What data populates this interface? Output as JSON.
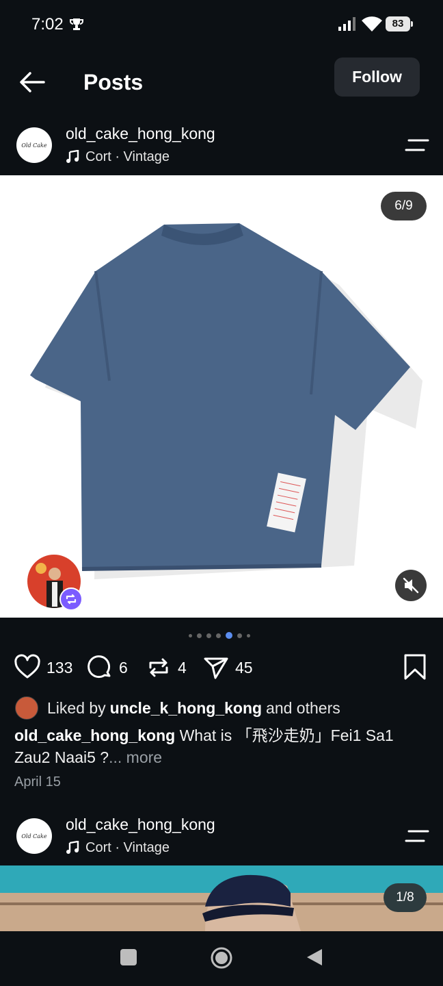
{
  "status_bar": {
    "time": "7:02",
    "battery": "83"
  },
  "header": {
    "title": "Posts",
    "follow_label": "Follow"
  },
  "post1": {
    "avatar_text": "Old Cake",
    "username": "old_cake_hong_kong",
    "music": "Cort · Vintage",
    "counter": "6/9",
    "counts": {
      "likes": "133",
      "comments": "6",
      "reposts": "4",
      "shares": "45"
    },
    "liked_prefix": "Liked by",
    "liked_user": "uncle_k_hong_kong",
    "liked_suffix": "and others",
    "caption_user": "old_cake_hong_kong",
    "caption_text": "What is 「飛沙走奶」Fei1 Sa1 Zau2 Naai5 ?",
    "caption_more": "... more",
    "date": "April 15"
  },
  "post2": {
    "avatar_text": "Old Cake",
    "username": "old_cake_hong_kong",
    "music": "Cort · Vintage",
    "counter": "1/8"
  },
  "colors": {
    "accent": "#5b8def",
    "background": "#0c1014",
    "repost_badge": "#7b5cff"
  }
}
